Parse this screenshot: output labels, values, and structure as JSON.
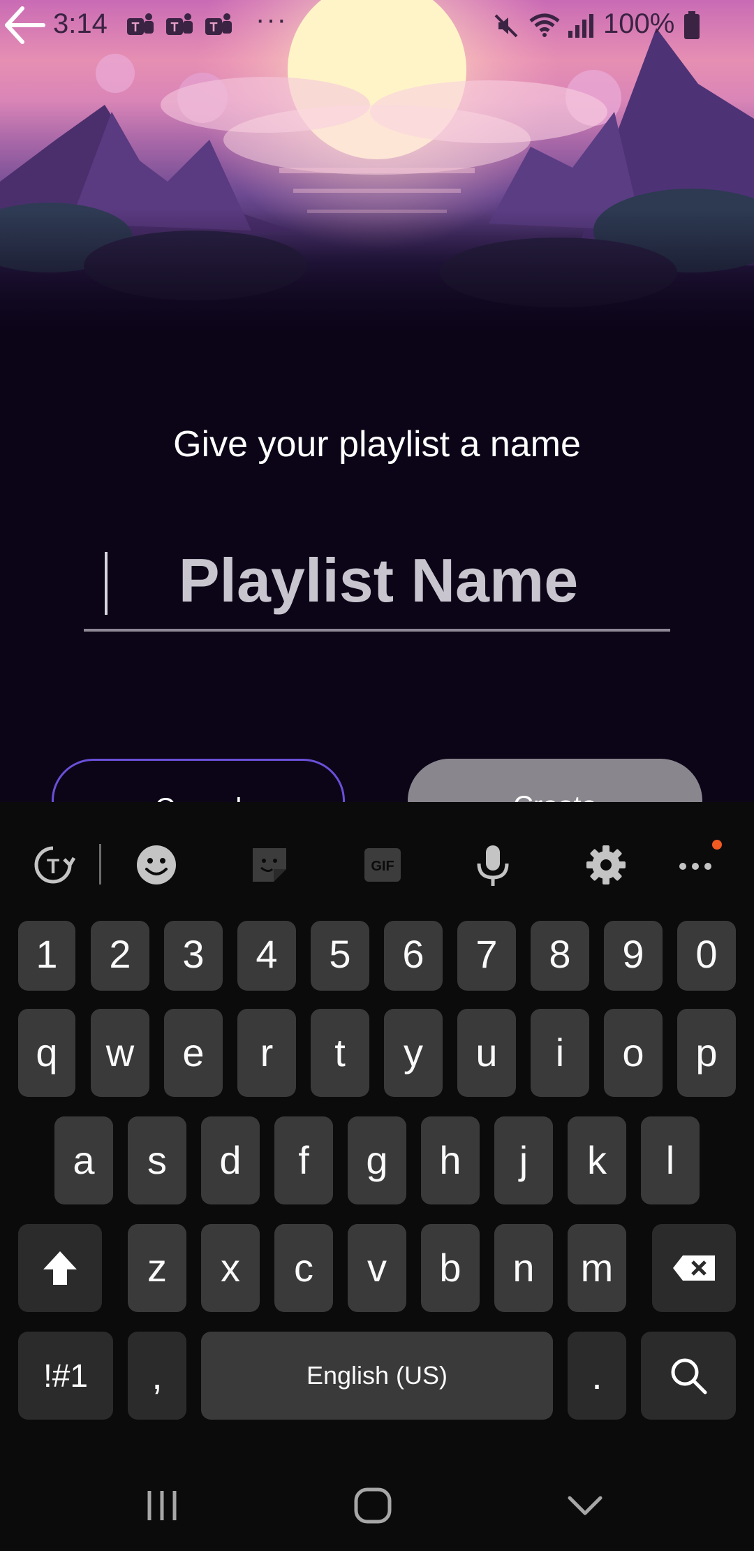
{
  "status_bar": {
    "time": "3:14",
    "more_dots": "···",
    "battery_percent": "100%"
  },
  "main": {
    "prompt": "Give your playlist a name",
    "name_input": {
      "value": "",
      "placeholder": "Playlist Name"
    },
    "cancel_label": "Cancel",
    "create_label": "Create"
  },
  "keyboard": {
    "toolbar_icons": [
      "translate-icon",
      "emoji-icon",
      "sticker-icon",
      "gif-icon",
      "microphone-icon",
      "gear-icon",
      "more-icon"
    ],
    "gif_label": "GIF",
    "number_row": [
      "1",
      "2",
      "3",
      "4",
      "5",
      "6",
      "7",
      "8",
      "9",
      "0"
    ],
    "row1": [
      "q",
      "w",
      "e",
      "r",
      "t",
      "y",
      "u",
      "i",
      "o",
      "p"
    ],
    "row2": [
      "a",
      "s",
      "d",
      "f",
      "g",
      "h",
      "j",
      "k",
      "l"
    ],
    "row3": [
      "z",
      "x",
      "c",
      "v",
      "b",
      "n",
      "m"
    ],
    "symbols_label": "!#1",
    "comma_label": ",",
    "space_label": "English (US)",
    "period_label": ".",
    "accent_dot_color": "#f05a22"
  },
  "colors": {
    "background": "#0c0518",
    "cancel_border": "#6a4fd8",
    "create_bg": "#8a868e"
  }
}
